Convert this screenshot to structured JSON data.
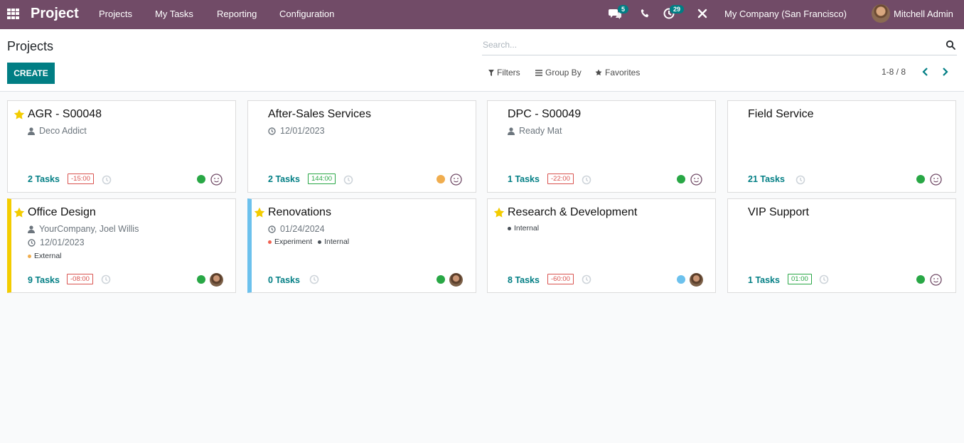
{
  "navbar": {
    "app_title": "Project",
    "menus": [
      "Projects",
      "My Tasks",
      "Reporting",
      "Configuration"
    ],
    "messages_badge": "5",
    "activities_badge": "29",
    "company": "My Company (San Francisco)",
    "user": "Mitchell Admin"
  },
  "control": {
    "breadcrumb": "Projects",
    "create_label": "CREATE",
    "search_placeholder": "Search...",
    "filters_label": "Filters",
    "groupby_label": "Group By",
    "favorites_label": "Favorites",
    "pager": "1-8 / 8"
  },
  "colors": {
    "brand": "#714b67",
    "accent": "#017e84",
    "star": "#f3cc00",
    "status_green": "#28a745",
    "status_orange": "#f0ad4e",
    "status_blue": "#6cc1ed"
  },
  "projects": [
    {
      "title": "AGR - S00048",
      "favorite": true,
      "customer": "Deco Addict",
      "tasks_count": "2",
      "tasks_label": "Tasks",
      "hours": "-15:00",
      "status": "green",
      "assignee": "smile-icon"
    },
    {
      "title": "After-Sales Services",
      "favorite": false,
      "date": "12/01/2023",
      "tasks_count": "2",
      "tasks_label": "Tasks",
      "hours": "144:00",
      "status": "orange",
      "assignee": "smile-icon"
    },
    {
      "title": "DPC - S00049",
      "favorite": false,
      "customer": "Ready Mat",
      "tasks_count": "1",
      "tasks_label": "Tasks",
      "hours": "-22:00",
      "status": "green",
      "assignee": "smile-icon"
    },
    {
      "title": "Field Service",
      "favorite": false,
      "tasks_count": "21",
      "tasks_label": "Tasks",
      "status": "green",
      "assignee": "smile-icon"
    },
    {
      "title": "Office Design",
      "favorite": true,
      "customer": "YourCompany, Joel Willis",
      "date": "12/01/2023",
      "tags": [
        "External"
      ],
      "tasks_count": "9",
      "tasks_label": "Tasks",
      "hours": "-08:00",
      "status": "green",
      "assignee": "avatar"
    },
    {
      "title": "Renovations",
      "favorite": true,
      "date": "01/24/2024",
      "tags": [
        "Experiment",
        "Internal"
      ],
      "tasks_count": "0",
      "tasks_label": "Tasks",
      "status": "green",
      "assignee": "avatar"
    },
    {
      "title": "Research & Development",
      "favorite": true,
      "tags": [
        "Internal"
      ],
      "tasks_count": "8",
      "tasks_label": "Tasks",
      "hours": "-60:00",
      "status": "blue",
      "assignee": "avatar"
    },
    {
      "title": "VIP Support",
      "favorite": false,
      "tasks_count": "1",
      "tasks_label": "Tasks",
      "hours": "01:00",
      "status": "green",
      "assignee": "smile-icon"
    }
  ]
}
